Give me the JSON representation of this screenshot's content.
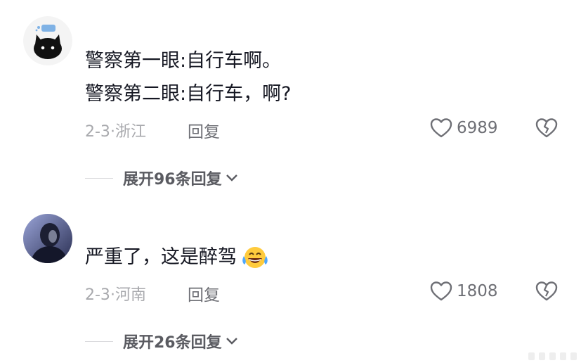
{
  "comments": [
    {
      "lines": [
        "警察第一眼:自行车啊。",
        "警察第二眼:自行车，啊?"
      ],
      "date": "2-3",
      "location": "浙江",
      "reply_label": "回复",
      "likes": "6989",
      "expand_label": "展开96条回复",
      "avatar_icon": "black-cat-avatar"
    },
    {
      "lines": [
        "严重了，这是醉驾"
      ],
      "date": "2-3",
      "location": "河南",
      "reply_label": "回复",
      "likes": "1808",
      "expand_label": "展开26条回复",
      "avatar_icon": "person-photo-avatar",
      "emoji": "tears-of-joy-emoji"
    }
  ],
  "colors": {
    "text": "#161823",
    "meta": "#a8a9ad",
    "action": "#6e6f75"
  }
}
